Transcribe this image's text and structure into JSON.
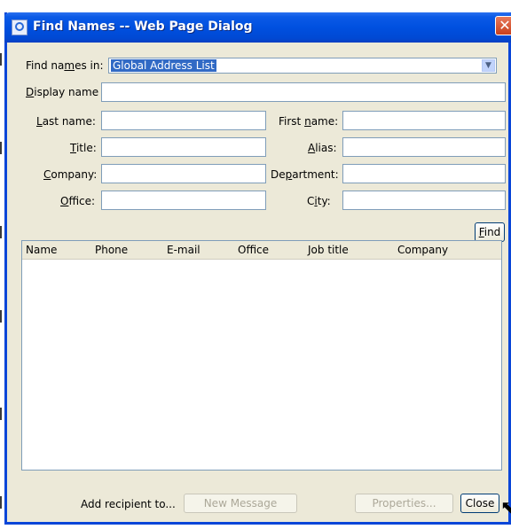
{
  "window": {
    "title": "Find Names -- Web Page Dialog",
    "close_glyph": "✕"
  },
  "form": {
    "find_in_label_pre": "Find na",
    "find_in_label_ul": "m",
    "find_in_label_post": "es in:",
    "find_in_value": "Global Address List",
    "display_name_ul": "D",
    "display_name_rest": "isplay name",
    "last_name_ul": "L",
    "last_name_rest": "ast name:",
    "first_name_pre": "First ",
    "first_name_ul": "n",
    "first_name_post": "ame:",
    "title_ul": "T",
    "title_rest": "itle:",
    "alias_ul": "A",
    "alias_rest": "lias:",
    "company_ul": "C",
    "company_rest": "ompany:",
    "department_pre": "De",
    "department_ul": "p",
    "department_post": "artment:",
    "office_ul": "O",
    "office_rest": "ffice:",
    "city_pre": "C",
    "city_ul": "i",
    "city_post": "ty:"
  },
  "find_button": {
    "ul": "F",
    "rest": "ind"
  },
  "results": {
    "columns": [
      "Name",
      "Phone",
      "E-mail",
      "Office",
      "Job title",
      "Company"
    ],
    "rows": []
  },
  "footer": {
    "add_recipient_label": "Add recipient to...",
    "new_message": "New Message",
    "properties": "Properties...",
    "close": "Close"
  }
}
